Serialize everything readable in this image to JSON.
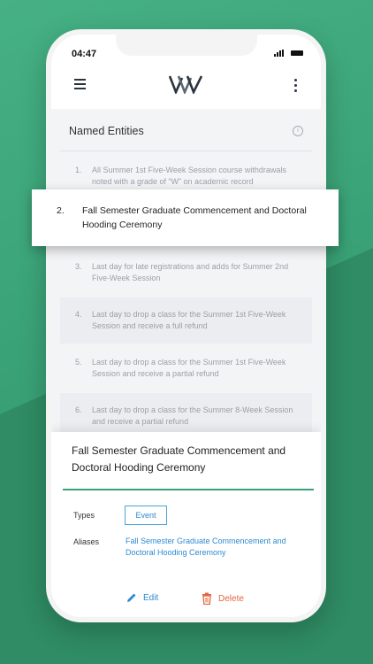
{
  "status": {
    "time": "04:47"
  },
  "panel": {
    "title": "Named Entities"
  },
  "entities": [
    {
      "num": "1.",
      "text": "All Summer 1st Five-Week Session course withdrawals noted with a grade of “W” on academic record"
    },
    {
      "num": "2.",
      "text": "Fall Semester Graduate Commencement and Doctoral Hooding Ceremony"
    },
    {
      "num": "3.",
      "text": "Last day for late registrations and adds for Summer 2nd Five-Week Session"
    },
    {
      "num": "4.",
      "text": "Last day to drop a class for the Summer 1st Five-Week Session and receive a full refund"
    },
    {
      "num": "5.",
      "text": "Last day to drop a class for the Summer 1st Five-Week Session and receive a partial refund"
    },
    {
      "num": "6.",
      "text": "Last day to drop a class for the Summer 8-Week Session and receive a partial refund"
    }
  ],
  "detail": {
    "title": "Fall Semester Graduate Commencement and Doctoral Hooding Ceremony",
    "types_label": "Types",
    "type_value": "Event",
    "aliases_label": "Aliases",
    "aliases_value": "Fall Semester Graduate Commencement and Doctoral Hooding Ceremony",
    "edit_label": "Edit",
    "delete_label": "Delete"
  },
  "colors": {
    "accent": "#3aa277",
    "link": "#2d8ad0",
    "danger": "#e2663d"
  },
  "icons": [
    "menu-icon",
    "logo",
    "more-vertical-icon",
    "info-icon",
    "pencil-icon",
    "trash-icon"
  ]
}
